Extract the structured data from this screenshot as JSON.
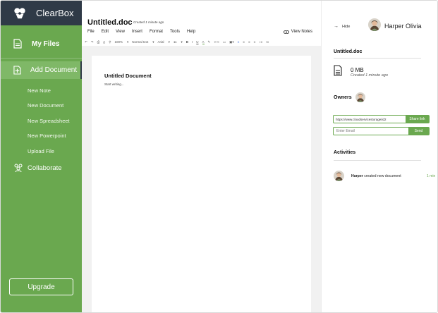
{
  "app": {
    "name": "ClearBox",
    "colors": {
      "brand_green": "#6aa84f",
      "dark_bar": "#2f3a47",
      "active_item": "#7fb867"
    }
  },
  "sidebar": {
    "my_files": "My Files",
    "add_document": "Add Document",
    "sub_items": [
      "New Note",
      "New Document",
      "New Spreadsheet",
      "New Powerpoint",
      "Upload File"
    ],
    "collaborate": "Collaborate",
    "upgrade": "Upgrade"
  },
  "editor": {
    "title": "Untitled.doc",
    "created": "Created 1 minute ago",
    "menu": [
      "File",
      "Edit",
      "View",
      "Insert",
      "Format",
      "Tools",
      "Help"
    ],
    "view_notes": "View Notes",
    "toolbar": {
      "zoom": "100%",
      "style": "Normal text",
      "font": "Arial",
      "size": "11"
    },
    "page_title": "Untitled Document",
    "page_body": "Start writing..."
  },
  "panel": {
    "hide": "Hide",
    "user_name": "Harper Olivia",
    "doc_title": "Untitled.doc",
    "file_size": "0 MB",
    "file_created": "Created 1 minute ago",
    "owners_label": "Owners",
    "share_link_value": "https://www.cloudservicestorage/id2",
    "share_link_button": "Share link",
    "email_placeholder": "Enter Email",
    "send_button": "Send",
    "activities_label": "Activities",
    "activities": [
      {
        "user": "Harper",
        "action": "created new document",
        "time": "1 min"
      }
    ]
  }
}
